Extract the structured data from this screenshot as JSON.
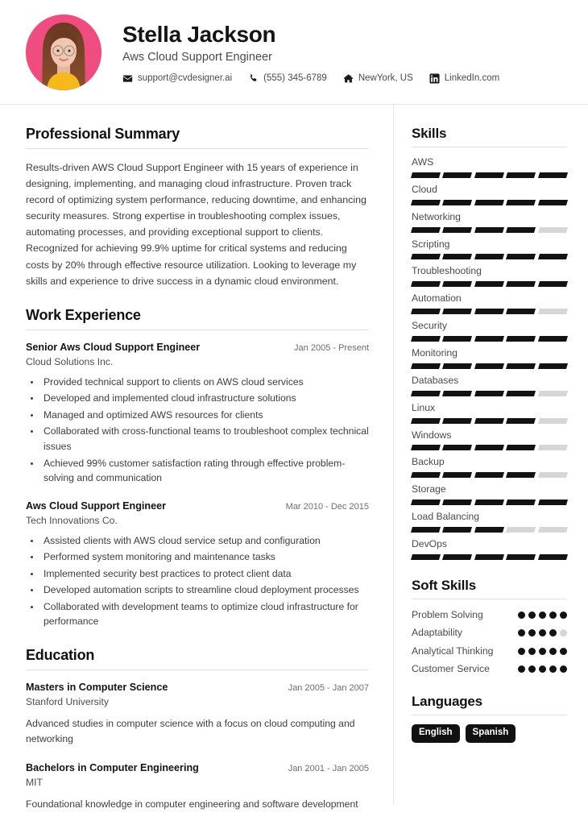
{
  "header": {
    "full_name": "Stella Jackson",
    "job_title": "Aws Cloud Support Engineer",
    "avatar": {
      "background_color": "#ef4d7f",
      "alt": "avatar-photo"
    },
    "contacts": [
      {
        "icon": "envelope-icon",
        "text": "support@cvdesigner.ai"
      },
      {
        "icon": "phone-icon",
        "text": "(555) 345-6789"
      },
      {
        "icon": "home-icon",
        "text": "NewYork, US"
      },
      {
        "icon": "linkedin-icon",
        "text": "LinkedIn.com"
      }
    ]
  },
  "main": {
    "summary": {
      "title": "Professional Summary",
      "text": "Results-driven AWS Cloud Support Engineer with 15 years of experience in designing, implementing, and managing cloud infrastructure. Proven track record of optimizing system performance, reducing downtime, and enhancing security measures. Strong expertise in troubleshooting complex issues, automating processes, and providing exceptional support to clients. Recognized for achieving 99.9% uptime for critical systems and reducing costs by 20% through effective resource utilization. Looking to leverage my skills and experience to drive success in a dynamic cloud environment."
    },
    "work_experience": {
      "title": "Work Experience",
      "entries": [
        {
          "role": "Senior Aws Cloud Support Engineer",
          "date": "Jan 2005 - Present",
          "organization": "Cloud Solutions Inc.",
          "bullets": [
            "Provided technical support to clients on AWS cloud services",
            "Developed and implemented cloud infrastructure solutions",
            "Managed and optimized AWS resources for clients",
            "Collaborated with cross-functional teams to troubleshoot complex technical issues",
            "Achieved 99% customer satisfaction rating through effective problem-solving and communication"
          ]
        },
        {
          "role": "Aws Cloud Support Engineer",
          "date": "Mar 2010 - Dec 2015",
          "organization": "Tech Innovations Co.",
          "bullets": [
            "Assisted clients with AWS cloud service setup and configuration",
            "Performed system monitoring and maintenance tasks",
            "Implemented security best practices to protect client data",
            "Developed automation scripts to streamline cloud deployment processes",
            "Collaborated with development teams to optimize cloud infrastructure for performance"
          ]
        }
      ]
    },
    "education": {
      "title": "Education",
      "entries": [
        {
          "degree": "Masters in Computer Science",
          "date": "Jan 2005 - Jan 2007",
          "organization": "Stanford University",
          "description": "Advanced studies in computer science with a focus on cloud computing and networking"
        },
        {
          "degree": "Bachelors in Computer Engineering",
          "date": "Jan 2001 - Jan 2005",
          "organization": "MIT",
          "description": "Foundational knowledge in computer engineering and software development"
        }
      ]
    }
  },
  "sidebar": {
    "skills": {
      "title": "Skills",
      "max_level": 5,
      "items": [
        {
          "name": "AWS",
          "level": 5
        },
        {
          "name": "Cloud",
          "level": 5
        },
        {
          "name": "Networking",
          "level": 4
        },
        {
          "name": "Scripting",
          "level": 5
        },
        {
          "name": "Troubleshooting",
          "level": 5
        },
        {
          "name": "Automation",
          "level": 4
        },
        {
          "name": "Security",
          "level": 5
        },
        {
          "name": "Monitoring",
          "level": 5
        },
        {
          "name": "Databases",
          "level": 4
        },
        {
          "name": "Linux",
          "level": 4
        },
        {
          "name": "Windows",
          "level": 4
        },
        {
          "name": "Backup",
          "level": 4
        },
        {
          "name": "Storage",
          "level": 5
        },
        {
          "name": "Load Balancing",
          "level": 3
        },
        {
          "name": "DevOps",
          "level": 5
        }
      ]
    },
    "soft_skills": {
      "title": "Soft Skills",
      "max_level": 5,
      "items": [
        {
          "name": "Problem Solving",
          "level": 5
        },
        {
          "name": "Adaptability",
          "level": 4
        },
        {
          "name": "Analytical Thinking",
          "level": 5
        },
        {
          "name": "Customer Service",
          "level": 5
        }
      ]
    },
    "languages": {
      "title": "Languages",
      "items": [
        "English",
        "Spanish"
      ]
    }
  },
  "colors": {
    "accent": "#ef4d7f",
    "filled": "#121212",
    "empty": "#d6d6d6",
    "rule": "#e0e0e0"
  }
}
